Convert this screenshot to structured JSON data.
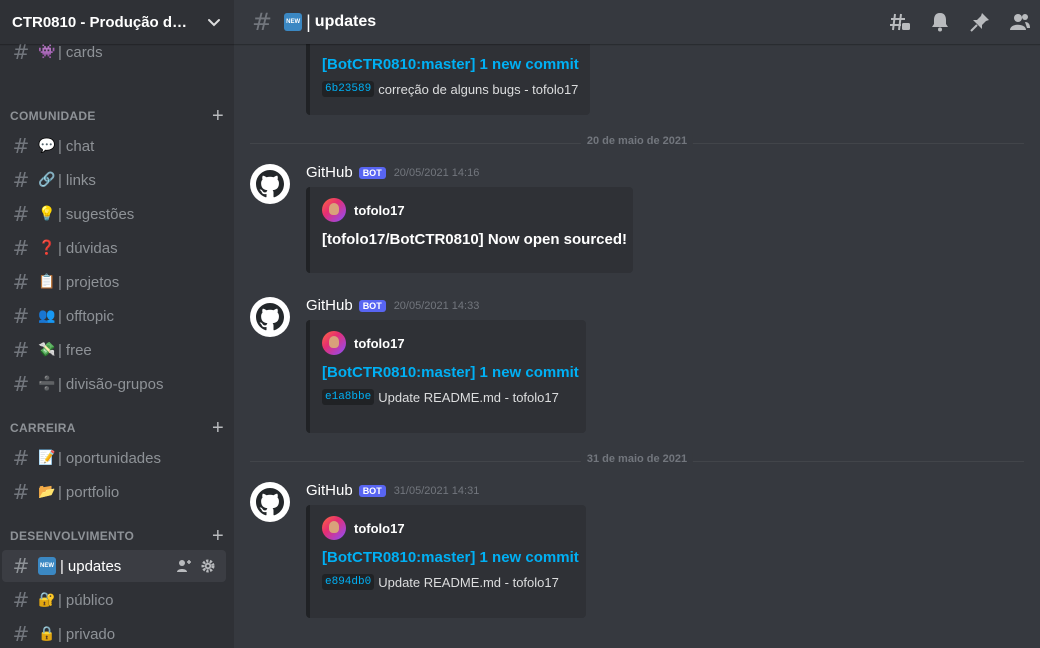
{
  "server": {
    "name": "CTR0810 - Produção de ...",
    "dropdown_icon": "chevron-down-icon"
  },
  "sidebar": {
    "top_channels": [
      {
        "emoji": "👾",
        "name": "cards"
      }
    ],
    "categories": [
      {
        "name": "COMUNIDADE",
        "channels": [
          {
            "emoji": "💬",
            "name": "chat"
          },
          {
            "emoji": "🔗",
            "name": "links"
          },
          {
            "emoji": "💡",
            "name": "sugestões"
          },
          {
            "emoji": "❓",
            "name": "dúvidas"
          },
          {
            "emoji": "📋",
            "name": "projetos"
          },
          {
            "emoji": "👥",
            "name": "offtopic"
          },
          {
            "emoji": "💸",
            "name": "free"
          },
          {
            "emoji": "➗",
            "name": "divisão-grupos"
          }
        ]
      },
      {
        "name": "CARREIRA",
        "channels": [
          {
            "emoji": "📝",
            "name": "oportunidades"
          },
          {
            "emoji": "📂",
            "name": "portfolio"
          }
        ]
      },
      {
        "name": "DESENVOLVIMENTO",
        "channels": [
          {
            "emoji": "NEW",
            "name": "updates"
          },
          {
            "emoji": "🔐",
            "name": "público"
          },
          {
            "emoji": "🔒",
            "name": "privado"
          }
        ]
      }
    ],
    "separator": "|"
  },
  "header": {
    "channel_badge": "NEW",
    "separator": "|",
    "channel_name": "updates",
    "icons": [
      "threads-icon",
      "bell-icon",
      "pin-icon",
      "members-icon"
    ]
  },
  "messages": {
    "first_embed": {
      "title": "[BotCTR0810:master] 1 new commit",
      "commit_hash": "6b23589",
      "commit_msg": "correção de alguns bugs - tofolo17"
    },
    "dividers": [
      "20 de maio de 2021",
      "31 de maio de 2021"
    ],
    "items": [
      {
        "author": "GitHub",
        "badge": "BOT",
        "time": "20/05/2021 14:16",
        "embed_author": "tofolo17",
        "title": "[tofolo17/BotCTR0810] Now open sourced!",
        "commit_hash": "",
        "commit_msg": ""
      },
      {
        "author": "GitHub",
        "badge": "BOT",
        "time": "20/05/2021 14:33",
        "embed_author": "tofolo17",
        "title": "[BotCTR0810:master] 1 new commit",
        "commit_hash": "e1a8bbe",
        "commit_msg": "Update README.md - tofolo17"
      },
      {
        "author": "GitHub",
        "badge": "BOT",
        "time": "31/05/2021 14:31",
        "embed_author": "tofolo17",
        "title": "[BotCTR0810:master] 1 new commit",
        "commit_hash": "e894db0",
        "commit_msg": "Update README.md - tofolo17"
      }
    ]
  },
  "colors": {
    "accent_link": "#00b0f4",
    "bot_badge": "#5865f2",
    "sidebar_bg": "#2f3136",
    "main_bg": "#36393f"
  }
}
